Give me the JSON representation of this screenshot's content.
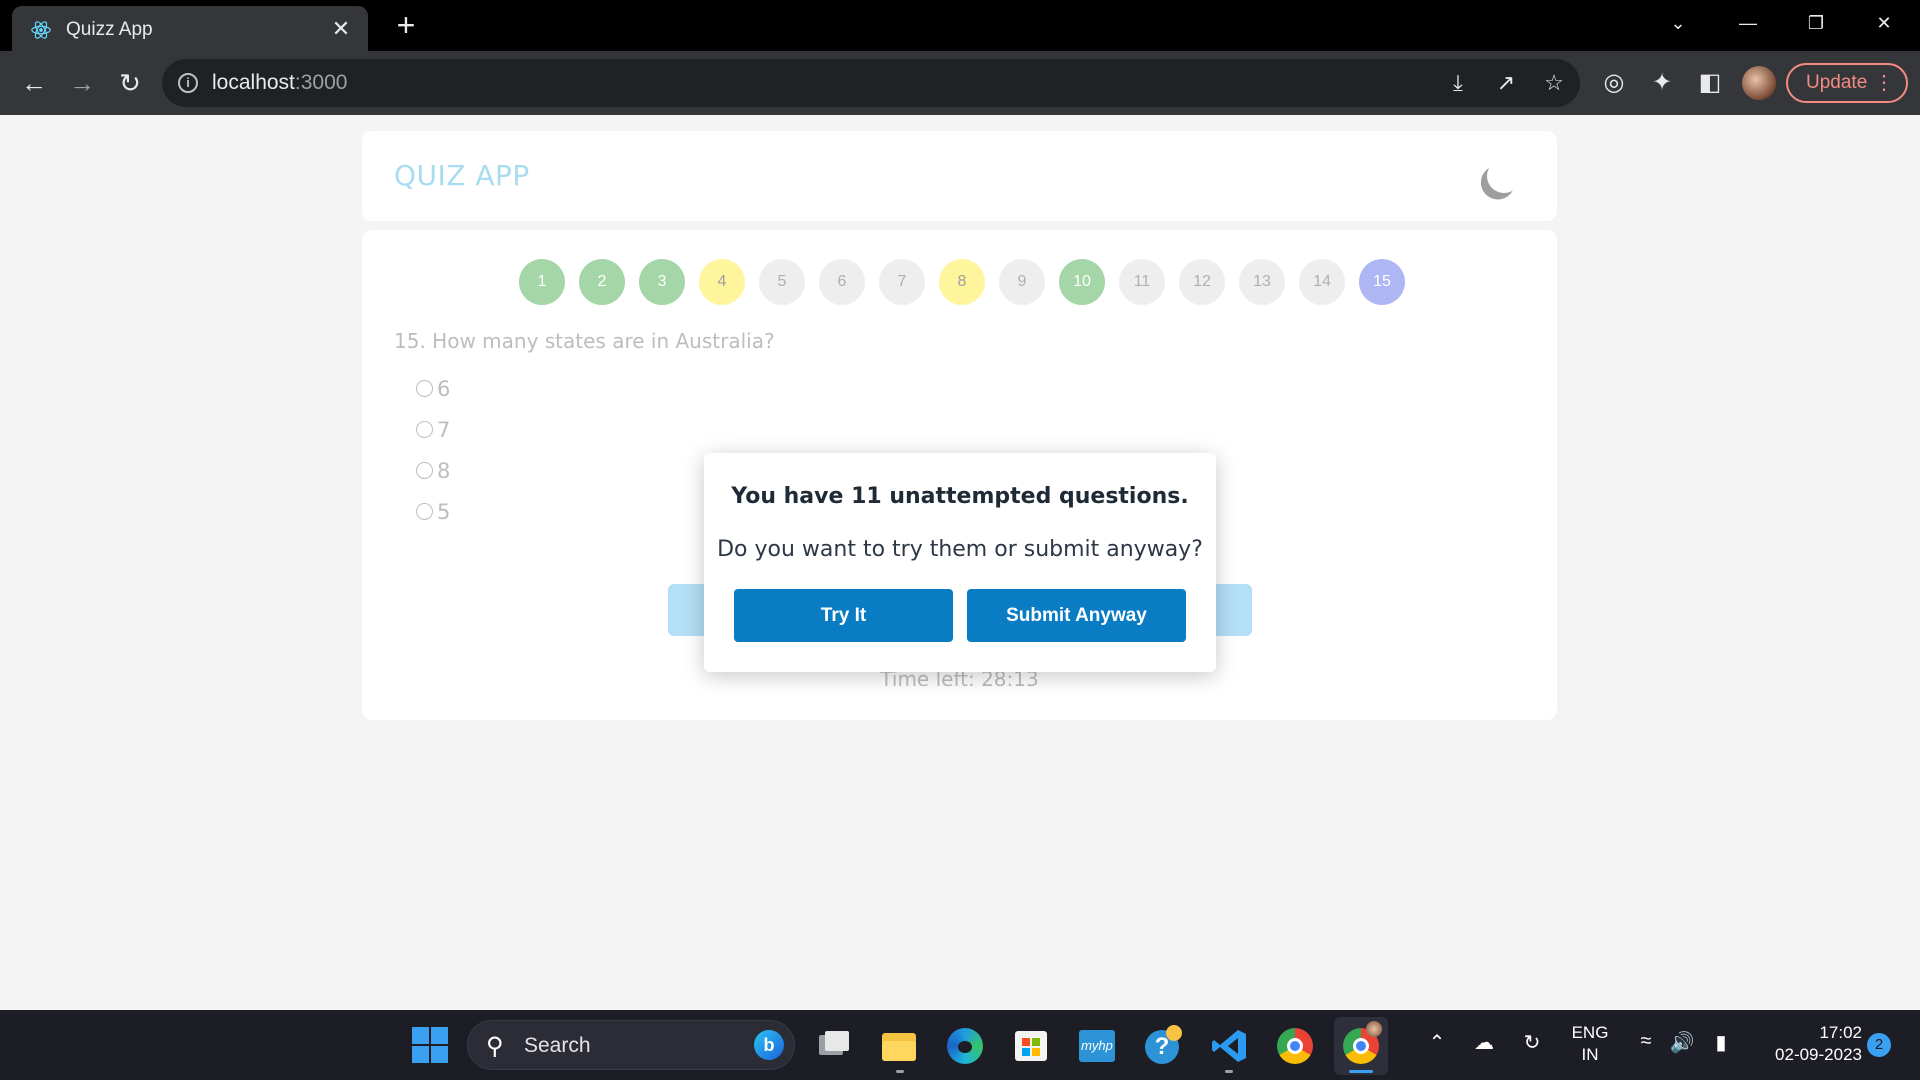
{
  "browser": {
    "tab_title": "Quizz App",
    "tab_close": "✕",
    "new_tab": "+",
    "url_host": "localhost",
    "url_port": ":3000",
    "update_label": "Update"
  },
  "app": {
    "title": "QUIZ APP",
    "question_numbers": [
      "1",
      "2",
      "3",
      "4",
      "5",
      "6",
      "7",
      "8",
      "9",
      "10",
      "11",
      "12",
      "13",
      "14",
      "15"
    ],
    "question": "15. How many states are in Australia?",
    "options": [
      "6",
      "7",
      "8",
      "5"
    ],
    "timer": "Time left: 28:13"
  },
  "modal": {
    "title": "You have 11 unattempted questions.",
    "text": "Do you want to try them or submit anyway?",
    "try_label": "Try It",
    "submit_label": "Submit Anyway"
  },
  "taskbar": {
    "search_label": "Search",
    "lang_line1": "ENG",
    "lang_line2": "IN",
    "time": "17:02",
    "date": "02-09-2023",
    "notifications": "2"
  },
  "colors": {
    "answered": "#a5d6a7",
    "marked": "#fff59d",
    "unvisited": "#eeeeee",
    "current": "#aeb7f4",
    "primary_button": "#0a7cc4"
  }
}
